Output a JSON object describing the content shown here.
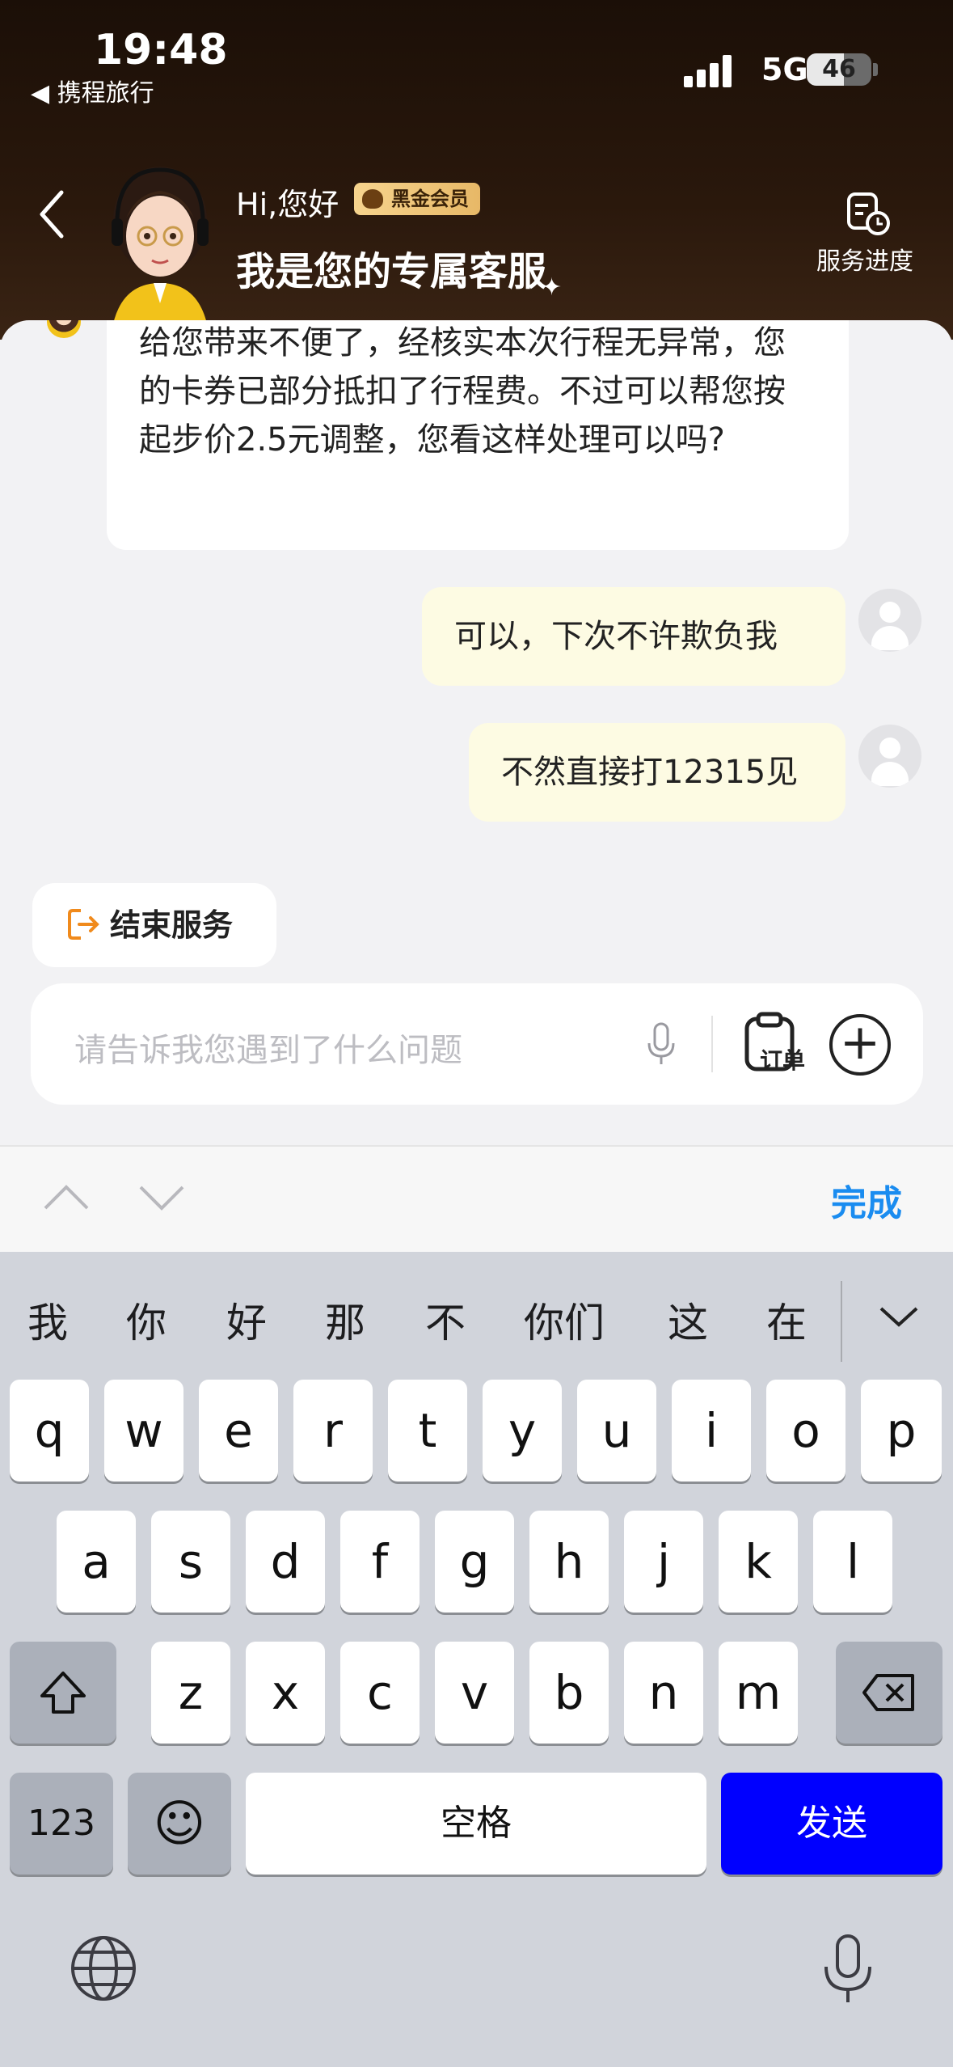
{
  "status_bar": {
    "time": "19:48",
    "back_app": "◀ 携程旅行",
    "network": "5G",
    "battery": "46"
  },
  "header": {
    "greeting": "Hi,您好",
    "member_badge": "黑金会员",
    "agent_title": "我是您的专属客服",
    "service_progress_label": "服务进度"
  },
  "chat": {
    "agent_message": "给您带来不便了，经核实本次行程无异常，您的卡券已部分抵扣了行程费。不过可以帮您按起步价2.5元调整，您看这样处理可以吗?",
    "user_messages": [
      {
        "text": "可以，下次不许欺负我"
      },
      {
        "text": "不然直接打12315见"
      }
    ]
  },
  "actions": {
    "end_service_label": "结束服务"
  },
  "composer": {
    "placeholder": "请告诉我您遇到了什么问题",
    "order_label": "订单",
    "plus_label": "+"
  },
  "accessory": {
    "done_label": "完成"
  },
  "keyboard": {
    "candidates": [
      "我",
      "你",
      "好",
      "那",
      "不",
      "你们",
      "这",
      "在"
    ],
    "row1": [
      "q",
      "w",
      "e",
      "r",
      "t",
      "y",
      "u",
      "i",
      "o",
      "p"
    ],
    "row2": [
      "a",
      "s",
      "d",
      "f",
      "g",
      "h",
      "j",
      "k",
      "l"
    ],
    "row3": [
      "z",
      "x",
      "c",
      "v",
      "b",
      "n",
      "m"
    ],
    "numbers_label": "123",
    "emoji_label": "☺",
    "space_label": "空格",
    "send_label": "发送"
  },
  "colors": {
    "header_bg": "#1b0f07",
    "badge_gold": "#f0c77a",
    "user_bubble": "#fdfbe3",
    "done_blue": "#1a8cf0",
    "send_blue": "#0000ff",
    "keyboard_bg": "#d1d4db"
  }
}
